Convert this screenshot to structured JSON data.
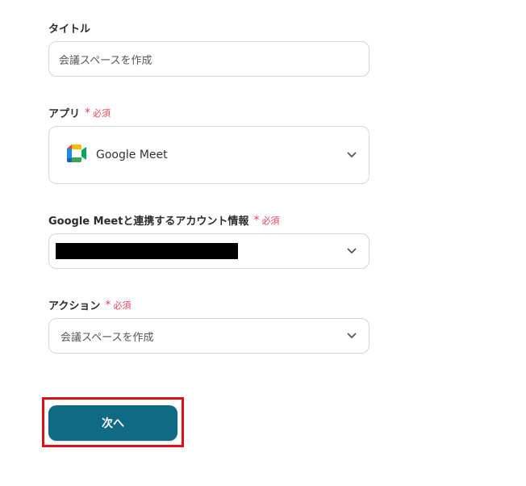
{
  "title_field": {
    "label": "タイトル",
    "value": "会議スペースを作成"
  },
  "app_field": {
    "label": "アプリ",
    "required_mark": "*",
    "required_text": "必須",
    "selected_app": "Google Meet",
    "icon": "google-meet-icon"
  },
  "account_field": {
    "label": "Google Meetと連携するアカウント情報",
    "required_mark": "*",
    "required_text": "必須",
    "value_redacted": true
  },
  "action_field": {
    "label": "アクション",
    "required_mark": "*",
    "required_text": "必須",
    "value": "会議スペースを作成"
  },
  "next_button": {
    "label": "次へ",
    "color": "#116a84",
    "highlight_color": "#e00d1a"
  },
  "colors": {
    "required": "#e0435c",
    "border": "#d6d6d6"
  }
}
